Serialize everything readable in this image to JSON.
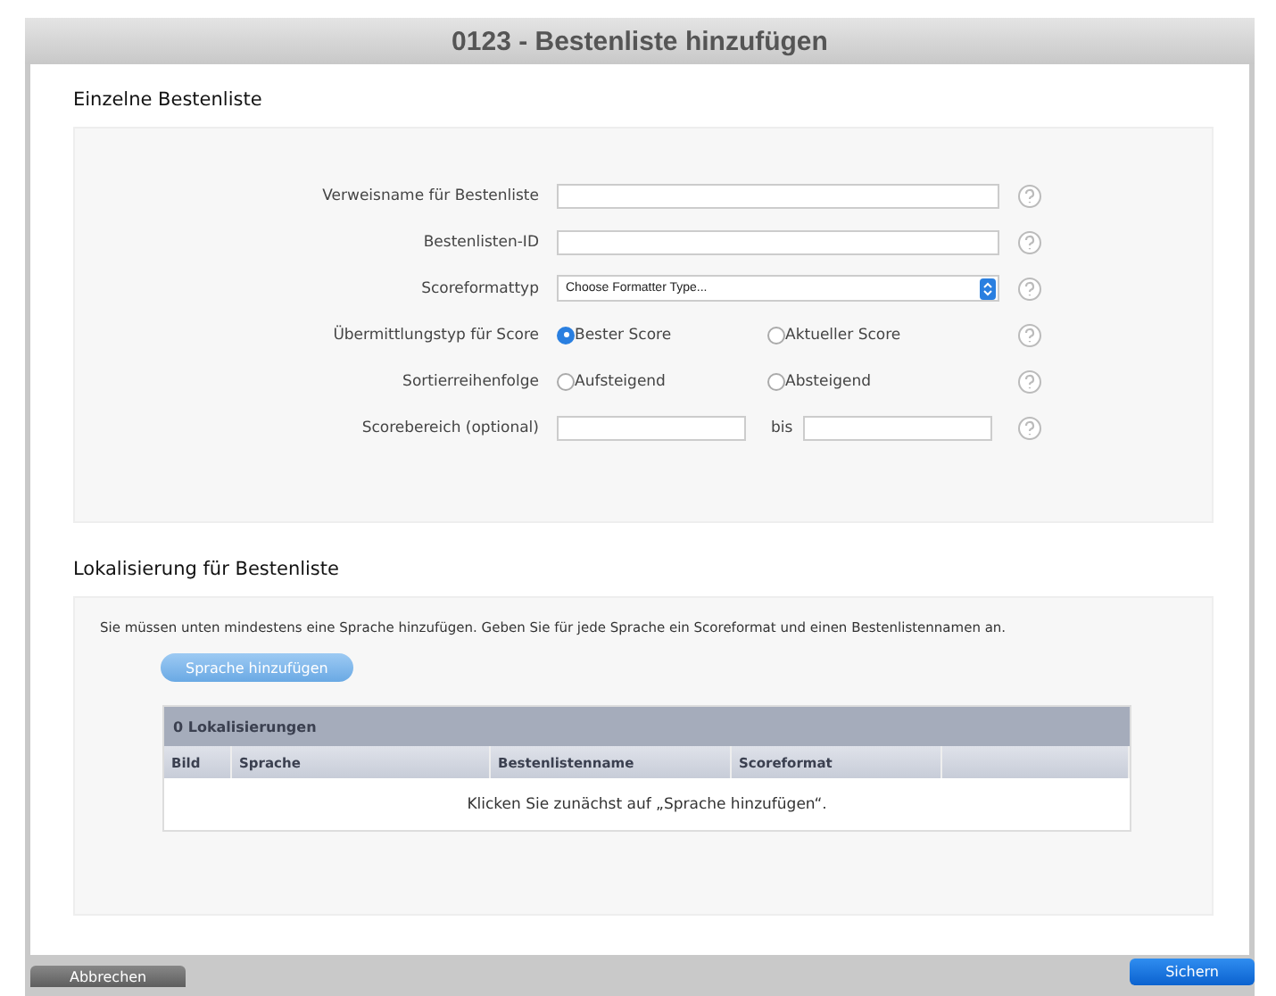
{
  "window": {
    "title": "0123 - Bestenliste hinzufügen"
  },
  "section_single": {
    "title": "Einzelne Bestenliste",
    "rows": [
      {
        "kind": "text",
        "label": "Verweisname für Bestenliste"
      },
      {
        "kind": "text",
        "label": "Bestenlisten-ID"
      },
      {
        "kind": "select",
        "label": "Scoreformattyp",
        "value": "Choose Formatter Type..."
      },
      {
        "kind": "radio",
        "label": "Übermittlungstyp für Score",
        "options": [
          {
            "label": "Bester Score",
            "selected": true
          },
          {
            "label": "Aktueller Score",
            "selected": false
          }
        ]
      },
      {
        "kind": "radio",
        "label": "Sortierreihenfolge",
        "options": [
          {
            "label": "Aufsteigend",
            "selected": false
          },
          {
            "label": "Absteigend",
            "selected": false
          }
        ]
      },
      {
        "kind": "range",
        "label": "Scorebereich (optional)",
        "separator": "bis"
      }
    ]
  },
  "section_localization": {
    "title": "Lokalisierung für Bestenliste",
    "info": "Sie müssen unten mindestens eine Sprache hinzufügen. Geben Sie für jede Sprache ein Scoreformat und einen Bestenlistennamen an.",
    "add_button": "Sprache hinzufügen",
    "table": {
      "title": "0 Lokalisierungen",
      "columns": [
        "Bild",
        "Sprache",
        "Bestenlistenname",
        "Scoreformat"
      ],
      "empty_message": "Klicken Sie zunächst auf „Sprache hinzufügen“."
    }
  },
  "footer": {
    "buttons": [
      {
        "label": "Abbrechen",
        "kind": "secondary"
      },
      {
        "label": "Sichern",
        "kind": "primary"
      }
    ]
  }
}
